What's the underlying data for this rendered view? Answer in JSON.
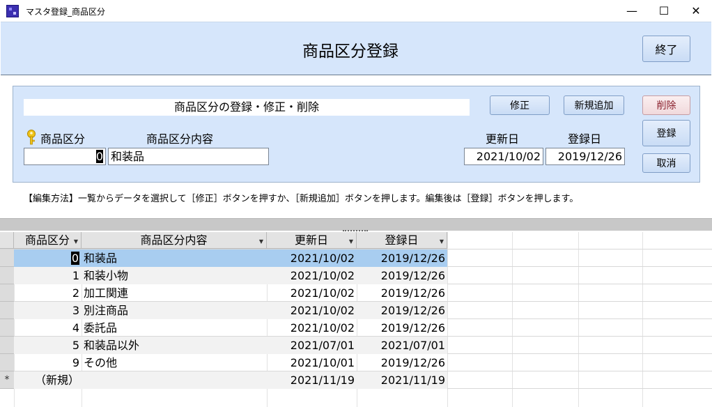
{
  "window": {
    "title": "マスタ登録_商品区分",
    "minimize_glyph": "—",
    "maximize_glyph": "☐",
    "close_glyph": "✕"
  },
  "header": {
    "title": "商品区分登録",
    "end_button": "終了"
  },
  "panel": {
    "heading": "商品区分の登録・修正・削除",
    "buttons": {
      "edit": "修正",
      "new": "新規追加",
      "delete": "削除",
      "register": "登録",
      "cancel": "取消"
    },
    "labels": {
      "code": "商品区分",
      "content": "商品区分内容",
      "updated": "更新日",
      "registered": "登録日"
    },
    "fields": {
      "code": "0",
      "content": "和装品",
      "updated": "2021/10/02",
      "registered": "2019/12/26"
    },
    "key_icon": "key-icon",
    "help_text": "【編集方法】一覧からデータを選択して［修正］ボタンを押すか、［新規追加］ボタンを押します。編集後は［登録］ボタンを押します。"
  },
  "grid": {
    "columns": [
      "商品区分",
      "商品区分内容",
      "更新日",
      "登録日"
    ],
    "rows": [
      {
        "code": "0",
        "content": "和装品",
        "updated": "2021/10/02",
        "registered": "2019/12/26"
      },
      {
        "code": "1",
        "content": "和装小物",
        "updated": "2021/10/02",
        "registered": "2019/12/26"
      },
      {
        "code": "2",
        "content": "加工関連",
        "updated": "2021/10/02",
        "registered": "2019/12/26"
      },
      {
        "code": "3",
        "content": "別注商品",
        "updated": "2021/10/02",
        "registered": "2019/12/26"
      },
      {
        "code": "4",
        "content": "委託品",
        "updated": "2021/10/02",
        "registered": "2019/12/26"
      },
      {
        "code": "5",
        "content": "和装品以外",
        "updated": "2021/07/01",
        "registered": "2021/07/01"
      },
      {
        "code": "9",
        "content": "その他",
        "updated": "2021/10/01",
        "registered": "2019/12/26"
      }
    ],
    "new_row": {
      "marker": "*",
      "code": "（新規）",
      "updated": "2021/11/19",
      "registered": "2021/11/19"
    },
    "selected_row": 0,
    "colors": {
      "selected": "#a8cdf0",
      "alt": "#f2f2f2",
      "header_band": "#d6e6fb"
    }
  }
}
